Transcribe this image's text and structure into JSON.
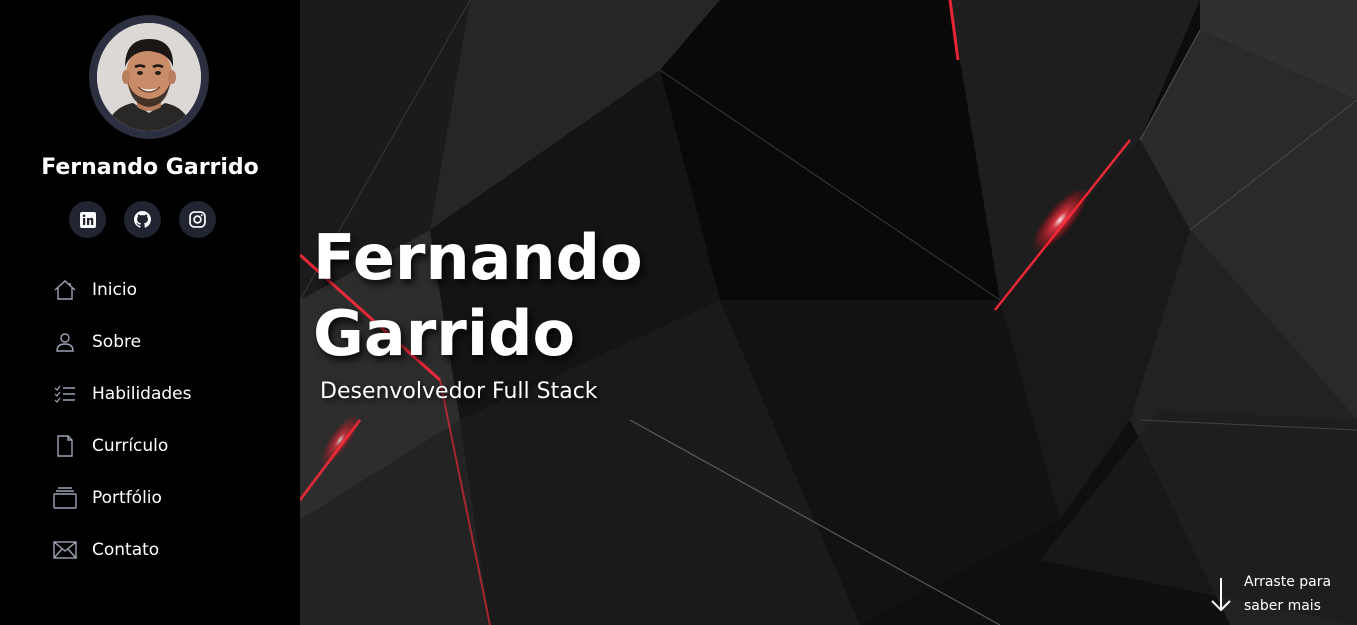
{
  "profile": {
    "name": "Fernando Garrido"
  },
  "socials": [
    {
      "icon": "linkedin-icon"
    },
    {
      "icon": "github-icon"
    },
    {
      "icon": "instagram-icon"
    }
  ],
  "nav": {
    "items": [
      {
        "label": "Inicio",
        "icon": "home-icon"
      },
      {
        "label": "Sobre",
        "icon": "user-icon"
      },
      {
        "label": "Habilidades",
        "icon": "list-check-icon"
      },
      {
        "label": "Currículo",
        "icon": "file-icon"
      },
      {
        "label": "Portfólio",
        "icon": "collection-icon"
      },
      {
        "label": "Contato",
        "icon": "envelope-icon"
      }
    ]
  },
  "hero": {
    "title_line1": "Fernando",
    "title_line2": "Garrido",
    "subtitle": "Desenvolvedor Full Stack",
    "scroll_hint_line1": "Arraste para",
    "scroll_hint_line2": "saber mais"
  },
  "colors": {
    "sidebar_bg": "#000000",
    "social_bg": "#212431",
    "avatar_ring": "#2c2f3f",
    "accent_red": "#ff2a3a"
  }
}
